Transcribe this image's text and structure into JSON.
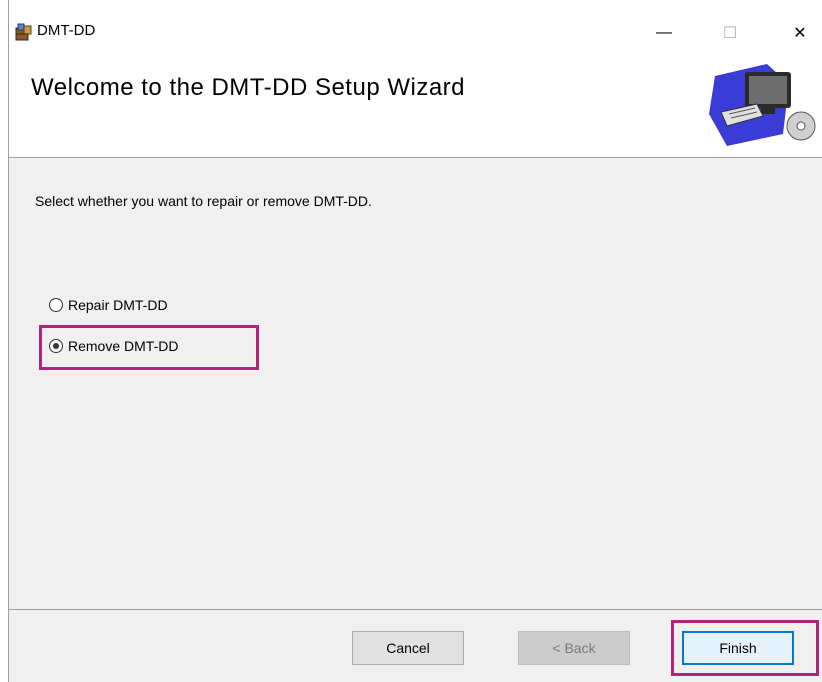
{
  "window": {
    "title": "DMT-DD",
    "minimize_glyph": "—",
    "maximize_glyph": "☐",
    "close_glyph": "✕"
  },
  "header": {
    "title": "Welcome to the DMT-DD Setup Wizard",
    "art_icon": "computer-cd-icon"
  },
  "main": {
    "instruction": "Select whether you want to repair or remove DMT-DD.",
    "options": [
      {
        "label": "Repair DMT-DD",
        "selected": false
      },
      {
        "label": "Remove DMT-DD",
        "selected": true
      }
    ]
  },
  "footer": {
    "cancel_label": "Cancel",
    "back_label": "< Back",
    "finish_label": "Finish"
  },
  "colors": {
    "highlight": "#b2247a",
    "focus": "#0078d7",
    "window_bg": "#f0f0f0"
  }
}
